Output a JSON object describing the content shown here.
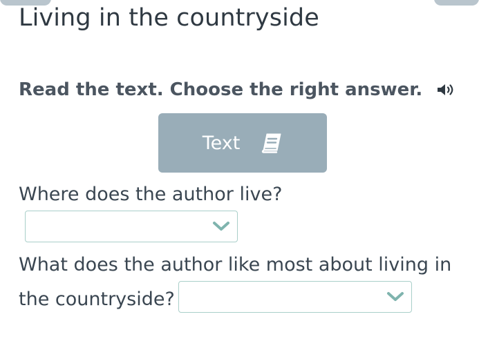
{
  "page": {
    "title": "Living in the countryside"
  },
  "instruction": {
    "text": "Read the text. Choose the right answer.",
    "audio_icon": "speaker-icon"
  },
  "text_button": {
    "label": "Text",
    "icon": "book-icon"
  },
  "questions": [
    {
      "lines": [
        "Where does the author live?"
      ],
      "selected_value": ""
    },
    {
      "lines": [
        "What does the author like most about living in",
        "the countryside?"
      ],
      "selected_value": ""
    }
  ],
  "colors": {
    "text": "#2f3942",
    "instruction_text": "#4b5560",
    "button_bg": "#99adb8",
    "dropdown_border": "#a9cfc9",
    "chevron": "#7fb4ae",
    "top_tab": "#b9c5cd"
  }
}
